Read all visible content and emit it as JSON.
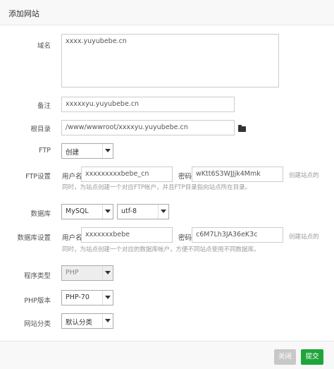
{
  "dialog": {
    "title": "添加网站"
  },
  "domain": {
    "label": "域名",
    "value": "xxxx.yuyubebe.cn"
  },
  "remark": {
    "label": "备注",
    "value": "xxxxxyu.yuyubebe.cn"
  },
  "root": {
    "label": "根目录",
    "value": "/www/wwwroot/xxxxyu.yuyubebe.cn",
    "icon": "folder-open-icon"
  },
  "ftp": {
    "label": "FTP",
    "select_value": "创建",
    "settings_label": "FTP设置",
    "user_label": "用户名",
    "user_value": "xxxxxxxxxbebe_cn",
    "pass_label": "密码",
    "pass_value": "wKtt6S3WJJjk4Mmk",
    "hint_line1": "创建站点的",
    "hint_line2": "同时，为站点创建一个对应FTP帐户，并且FTP目录指向站点所在目录。"
  },
  "database": {
    "label": "数据库",
    "type_value": "MySQL",
    "charset_value": "utf-8",
    "settings_label": "数据库设置",
    "user_label": "用户名",
    "user_value": "xxxxxxxbebe",
    "pass_label": "密码",
    "pass_value": "c6M7Lh3JA36eK3c",
    "hint_line1": "创建站点的",
    "hint_line2": "同时，为站点创建一个对应的数据库帐户，方便不同站点使用不同数据库。"
  },
  "program_type": {
    "label": "程序类型",
    "value": "PHP"
  },
  "php_version": {
    "label": "PHP版本",
    "value": "PHP-70"
  },
  "site_category": {
    "label": "网站分类",
    "value": "默认分类"
  },
  "buttons": {
    "close": "关闭",
    "submit": "提交"
  },
  "colors": {
    "submit": "#20a53a",
    "close": "#c8c8c8",
    "hint": "#999999"
  }
}
